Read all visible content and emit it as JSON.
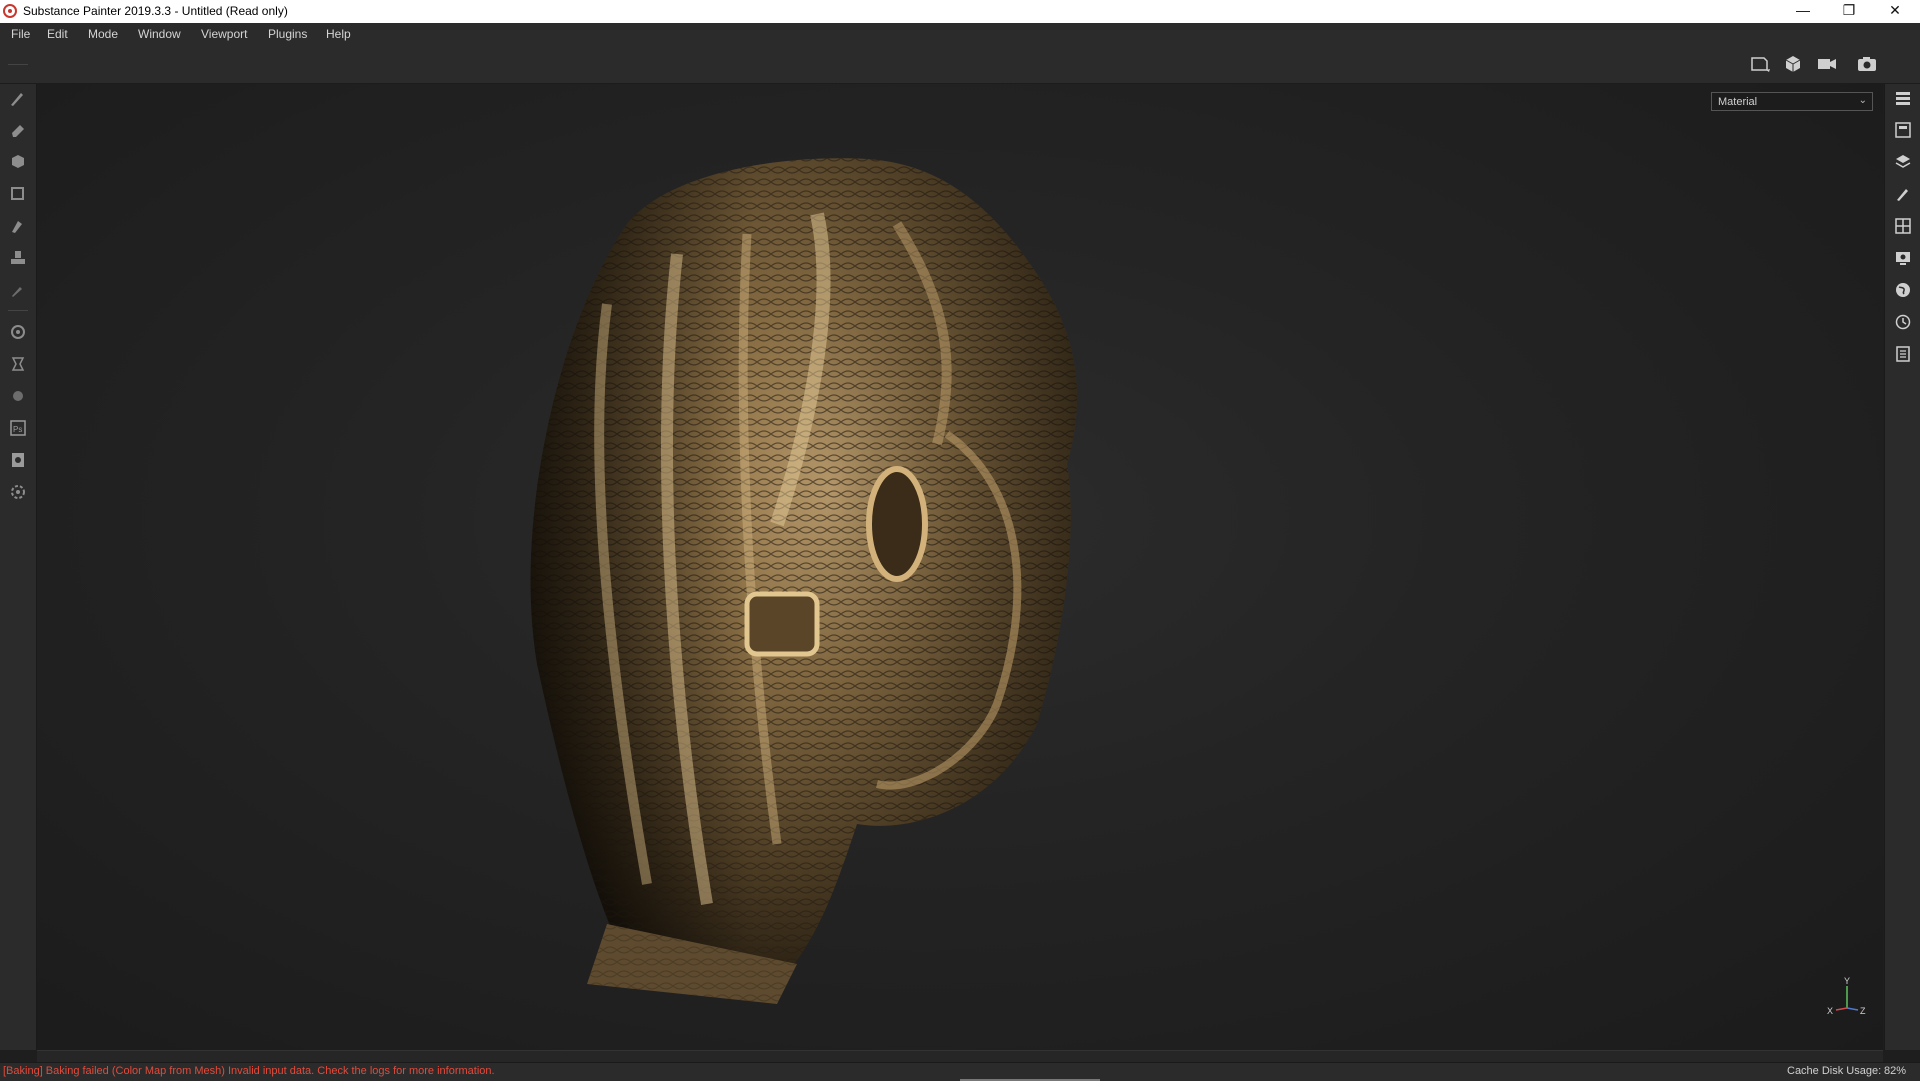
{
  "window": {
    "title": "Substance Painter 2019.3.3 - Untitled (Read only)",
    "controls": {
      "minimize": "—",
      "restore": "❐",
      "close": "✕"
    }
  },
  "menu": [
    "File",
    "Edit",
    "Mode",
    "Window",
    "Viewport",
    "Plugins",
    "Help"
  ],
  "toolbar_icons": [
    "display-settings-icon",
    "camera-view-icon",
    "video-icon",
    "screenshot-icon"
  ],
  "left_tools": [
    "paint-brush-icon",
    "eraser-icon",
    "projection-icon",
    "polygon-fill-icon",
    "smudge-icon",
    "clone-stamp-icon",
    "color-picker-icon",
    "bake-settings-icon",
    "iray-icon",
    "shader-icon",
    "photoshop-export-icon",
    "export-textures-icon",
    "settings-icon"
  ],
  "right_dock": [
    "texture-set-list-icon",
    "texture-set-settings-icon",
    "layers-icon",
    "properties-icon",
    "shelf-icon",
    "display-settings-icon",
    "environment-icon",
    "history-icon",
    "log-icon"
  ],
  "viewport": {
    "channel": "Material",
    "axes": {
      "y": "Y",
      "x": "X",
      "z": "Z"
    }
  },
  "status": {
    "error": "[Baking] Baking failed (Color Map from Mesh) Invalid input data. Check the logs for more information.",
    "cache_label": "Cache Disk Usage:",
    "cache_value": "82%"
  },
  "colors": {
    "error": "#e24a3b",
    "bronze": "#8a6f45",
    "panel": "#2b2b2b"
  }
}
